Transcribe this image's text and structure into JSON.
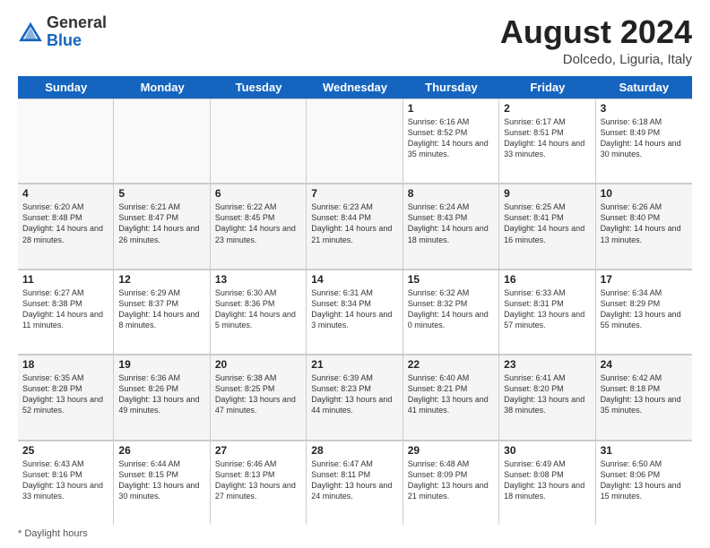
{
  "logo": {
    "general": "General",
    "blue": "Blue"
  },
  "title": {
    "month_year": "August 2024",
    "location": "Dolcedo, Liguria, Italy"
  },
  "days_header": [
    "Sunday",
    "Monday",
    "Tuesday",
    "Wednesday",
    "Thursday",
    "Friday",
    "Saturday"
  ],
  "weeks": [
    [
      {
        "day": "",
        "info": "",
        "empty": true
      },
      {
        "day": "",
        "info": "",
        "empty": true
      },
      {
        "day": "",
        "info": "",
        "empty": true
      },
      {
        "day": "",
        "info": "",
        "empty": true
      },
      {
        "day": "1",
        "info": "Sunrise: 6:16 AM\nSunset: 8:52 PM\nDaylight: 14 hours and 35 minutes."
      },
      {
        "day": "2",
        "info": "Sunrise: 6:17 AM\nSunset: 8:51 PM\nDaylight: 14 hours and 33 minutes."
      },
      {
        "day": "3",
        "info": "Sunrise: 6:18 AM\nSunset: 8:49 PM\nDaylight: 14 hours and 30 minutes."
      }
    ],
    [
      {
        "day": "4",
        "info": "Sunrise: 6:20 AM\nSunset: 8:48 PM\nDaylight: 14 hours and 28 minutes."
      },
      {
        "day": "5",
        "info": "Sunrise: 6:21 AM\nSunset: 8:47 PM\nDaylight: 14 hours and 26 minutes."
      },
      {
        "day": "6",
        "info": "Sunrise: 6:22 AM\nSunset: 8:45 PM\nDaylight: 14 hours and 23 minutes."
      },
      {
        "day": "7",
        "info": "Sunrise: 6:23 AM\nSunset: 8:44 PM\nDaylight: 14 hours and 21 minutes."
      },
      {
        "day": "8",
        "info": "Sunrise: 6:24 AM\nSunset: 8:43 PM\nDaylight: 14 hours and 18 minutes."
      },
      {
        "day": "9",
        "info": "Sunrise: 6:25 AM\nSunset: 8:41 PM\nDaylight: 14 hours and 16 minutes."
      },
      {
        "day": "10",
        "info": "Sunrise: 6:26 AM\nSunset: 8:40 PM\nDaylight: 14 hours and 13 minutes."
      }
    ],
    [
      {
        "day": "11",
        "info": "Sunrise: 6:27 AM\nSunset: 8:38 PM\nDaylight: 14 hours and 11 minutes."
      },
      {
        "day": "12",
        "info": "Sunrise: 6:29 AM\nSunset: 8:37 PM\nDaylight: 14 hours and 8 minutes."
      },
      {
        "day": "13",
        "info": "Sunrise: 6:30 AM\nSunset: 8:36 PM\nDaylight: 14 hours and 5 minutes."
      },
      {
        "day": "14",
        "info": "Sunrise: 6:31 AM\nSunset: 8:34 PM\nDaylight: 14 hours and 3 minutes."
      },
      {
        "day": "15",
        "info": "Sunrise: 6:32 AM\nSunset: 8:32 PM\nDaylight: 14 hours and 0 minutes."
      },
      {
        "day": "16",
        "info": "Sunrise: 6:33 AM\nSunset: 8:31 PM\nDaylight: 13 hours and 57 minutes."
      },
      {
        "day": "17",
        "info": "Sunrise: 6:34 AM\nSunset: 8:29 PM\nDaylight: 13 hours and 55 minutes."
      }
    ],
    [
      {
        "day": "18",
        "info": "Sunrise: 6:35 AM\nSunset: 8:28 PM\nDaylight: 13 hours and 52 minutes."
      },
      {
        "day": "19",
        "info": "Sunrise: 6:36 AM\nSunset: 8:26 PM\nDaylight: 13 hours and 49 minutes."
      },
      {
        "day": "20",
        "info": "Sunrise: 6:38 AM\nSunset: 8:25 PM\nDaylight: 13 hours and 47 minutes."
      },
      {
        "day": "21",
        "info": "Sunrise: 6:39 AM\nSunset: 8:23 PM\nDaylight: 13 hours and 44 minutes."
      },
      {
        "day": "22",
        "info": "Sunrise: 6:40 AM\nSunset: 8:21 PM\nDaylight: 13 hours and 41 minutes."
      },
      {
        "day": "23",
        "info": "Sunrise: 6:41 AM\nSunset: 8:20 PM\nDaylight: 13 hours and 38 minutes."
      },
      {
        "day": "24",
        "info": "Sunrise: 6:42 AM\nSunset: 8:18 PM\nDaylight: 13 hours and 35 minutes."
      }
    ],
    [
      {
        "day": "25",
        "info": "Sunrise: 6:43 AM\nSunset: 8:16 PM\nDaylight: 13 hours and 33 minutes."
      },
      {
        "day": "26",
        "info": "Sunrise: 6:44 AM\nSunset: 8:15 PM\nDaylight: 13 hours and 30 minutes."
      },
      {
        "day": "27",
        "info": "Sunrise: 6:46 AM\nSunset: 8:13 PM\nDaylight: 13 hours and 27 minutes."
      },
      {
        "day": "28",
        "info": "Sunrise: 6:47 AM\nSunset: 8:11 PM\nDaylight: 13 hours and 24 minutes."
      },
      {
        "day": "29",
        "info": "Sunrise: 6:48 AM\nSunset: 8:09 PM\nDaylight: 13 hours and 21 minutes."
      },
      {
        "day": "30",
        "info": "Sunrise: 6:49 AM\nSunset: 8:08 PM\nDaylight: 13 hours and 18 minutes."
      },
      {
        "day": "31",
        "info": "Sunrise: 6:50 AM\nSunset: 8:06 PM\nDaylight: 13 hours and 15 minutes."
      }
    ]
  ],
  "footer": {
    "note": "Daylight hours"
  }
}
